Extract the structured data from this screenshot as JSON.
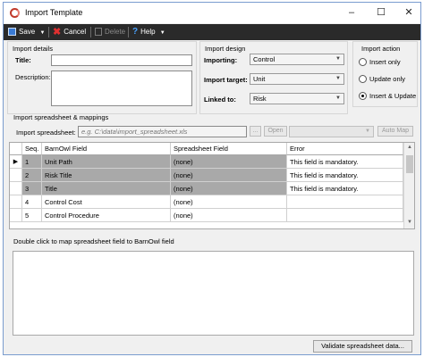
{
  "window": {
    "title": "Import Template"
  },
  "toolbar": {
    "save": "Save",
    "cancel": "Cancel",
    "delete": "Delete",
    "help": "Help"
  },
  "details": {
    "group": "Import details",
    "title_label": "Title:",
    "title_value": "",
    "description_label": "Description:",
    "description_value": ""
  },
  "design": {
    "group": "Import design",
    "importing_label": "Importing:",
    "importing_value": "Control",
    "target_label": "Import target:",
    "target_value": "Unit",
    "linked_label": "Linked to:",
    "linked_value": "Risk"
  },
  "action": {
    "group": "Import action",
    "options": [
      "Insert only",
      "Update only",
      "Insert & Update"
    ],
    "selected": "Insert & Update"
  },
  "mapping": {
    "group": "Import spreadsheet & mappings",
    "spreadsheet_label": "Import spreadsheet:",
    "spreadsheet_placeholder": "e.g. C:\\data\\import_spreadsheet.xls",
    "browse": "...",
    "open": "Open",
    "sheet_value": "",
    "auto_map": "Auto Map"
  },
  "grid": {
    "columns": [
      "Seq.",
      "BarnOwl Field",
      "Spreadsheet Field",
      "Error"
    ],
    "rows": [
      {
        "seq": "1",
        "field": "Unit Path",
        "sheet": "(none)",
        "error": "This field is mandatory.",
        "mandatory": true,
        "current": true
      },
      {
        "seq": "2",
        "field": "Risk Title",
        "sheet": "(none)",
        "error": "This field is mandatory.",
        "mandatory": true,
        "current": false
      },
      {
        "seq": "3",
        "field": "Title",
        "sheet": "(none)",
        "error": "This field is mandatory.",
        "mandatory": true,
        "current": false
      },
      {
        "seq": "4",
        "field": "Control Cost",
        "sheet": "(none)",
        "error": "",
        "mandatory": false,
        "current": false
      },
      {
        "seq": "5",
        "field": "Control Procedure",
        "sheet": "(none)",
        "error": "",
        "mandatory": false,
        "current": false
      }
    ]
  },
  "hint": "Double click to map spreadsheet field to BarnOwl field",
  "validate_button": "Validate spreadsheet data..."
}
